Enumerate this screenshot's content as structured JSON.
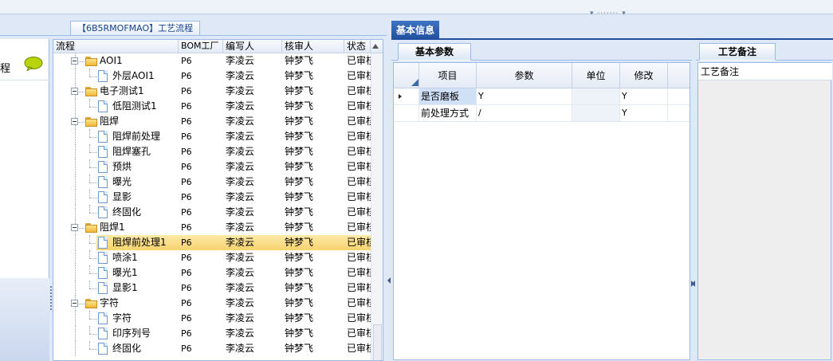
{
  "top": {
    "grip": "▾ ······· ▾"
  },
  "left_panel": {
    "tab_title": "【6B5RMOFMAO】工艺流程",
    "nav": {
      "label": "程"
    },
    "columns": [
      "流程",
      "BOM工厂",
      "编写人",
      "核审人",
      "状态"
    ],
    "rows": [
      {
        "name": "AOI1",
        "type": "folder",
        "level": 0,
        "bom": "P6",
        "author": "李凌云",
        "reviewer": "钟梦飞",
        "status": "已审核"
      },
      {
        "name": "外层AOI1",
        "type": "file",
        "level": 1,
        "bom": "P6",
        "author": "李凌云",
        "reviewer": "钟梦飞",
        "status": "已审核"
      },
      {
        "name": "电子测试1",
        "type": "folder",
        "level": 0,
        "bom": "P6",
        "author": "李凌云",
        "reviewer": "钟梦飞",
        "status": "已审核"
      },
      {
        "name": "低阻测试1",
        "type": "file",
        "level": 1,
        "bom": "P6",
        "author": "李凌云",
        "reviewer": "钟梦飞",
        "status": "已审核"
      },
      {
        "name": "阻焊",
        "type": "folder",
        "level": 0,
        "bom": "P6",
        "author": "李凌云",
        "reviewer": "钟梦飞",
        "status": "已审核"
      },
      {
        "name": "阻焊前处理",
        "type": "file",
        "level": 1,
        "bom": "P6",
        "author": "李凌云",
        "reviewer": "钟梦飞",
        "status": "已审核"
      },
      {
        "name": "阻焊塞孔",
        "type": "file",
        "level": 1,
        "bom": "P6",
        "author": "李凌云",
        "reviewer": "钟梦飞",
        "status": "已审核"
      },
      {
        "name": "预烘",
        "type": "file",
        "level": 1,
        "bom": "P6",
        "author": "李凌云",
        "reviewer": "钟梦飞",
        "status": "已审核"
      },
      {
        "name": "曝光",
        "type": "file",
        "level": 1,
        "bom": "P6",
        "author": "李凌云",
        "reviewer": "钟梦飞",
        "status": "已审核"
      },
      {
        "name": "显影",
        "type": "file",
        "level": 1,
        "bom": "P6",
        "author": "李凌云",
        "reviewer": "钟梦飞",
        "status": "已审核"
      },
      {
        "name": "终固化",
        "type": "file",
        "level": 1,
        "bom": "P6",
        "author": "李凌云",
        "reviewer": "钟梦飞",
        "status": "已审核"
      },
      {
        "name": "阻焊1",
        "type": "folder",
        "level": 0,
        "bom": "P6",
        "author": "李凌云",
        "reviewer": "钟梦飞",
        "status": "已审核"
      },
      {
        "name": "阻焊前处理1",
        "type": "file",
        "level": 1,
        "bom": "P6",
        "author": "李凌云",
        "reviewer": "钟梦飞",
        "status": "已审核",
        "selected": true
      },
      {
        "name": "喷涂1",
        "type": "file",
        "level": 1,
        "bom": "P6",
        "author": "李凌云",
        "reviewer": "钟梦飞",
        "status": "已审核"
      },
      {
        "name": "曝光1",
        "type": "file",
        "level": 1,
        "bom": "P6",
        "author": "李凌云",
        "reviewer": "钟梦飞",
        "status": "已审核"
      },
      {
        "name": "显影1",
        "type": "file",
        "level": 1,
        "bom": "P6",
        "author": "李凌云",
        "reviewer": "钟梦飞",
        "status": "已审核"
      },
      {
        "name": "字符",
        "type": "folder",
        "level": 0,
        "bom": "P6",
        "author": "李凌云",
        "reviewer": "钟梦飞",
        "status": "已审核"
      },
      {
        "name": "字符",
        "type": "file",
        "level": 1,
        "bom": "P6",
        "author": "李凌云",
        "reviewer": "钟梦飞",
        "status": "已审核"
      },
      {
        "name": "印序列号",
        "type": "file",
        "level": 1,
        "bom": "P6",
        "author": "李凌云",
        "reviewer": "钟梦飞",
        "status": "已审核"
      },
      {
        "name": "终固化",
        "type": "file",
        "level": 1,
        "bom": "P6",
        "author": "李凌云",
        "reviewer": "钟梦飞",
        "status": "已审核"
      }
    ]
  },
  "right": {
    "main_tab": "基本信息",
    "params": {
      "tab": "基本参数",
      "columns": [
        "项目",
        "参数",
        "单位",
        "修改"
      ],
      "rows": [
        {
          "item": "是否磨板",
          "param": "Y",
          "unit": "",
          "modify": "Y",
          "current": true
        },
        {
          "item": "前处理方式",
          "param": "/",
          "unit": "",
          "modify": "Y"
        }
      ]
    },
    "notes": {
      "tab": "工艺备注",
      "label": "工艺备注"
    }
  },
  "colors": {
    "accent": "#1f4f9c",
    "selection": "#f8d36e",
    "border": "#99bbe8"
  }
}
